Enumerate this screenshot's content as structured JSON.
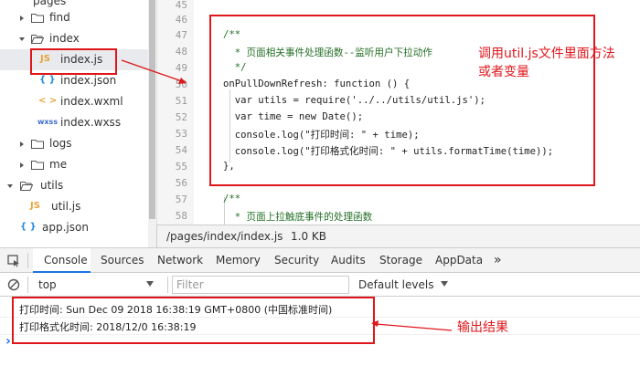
{
  "tree": {
    "items": [
      {
        "label": "find",
        "type": "folder",
        "expanded": false
      },
      {
        "label": "index",
        "type": "folder",
        "expanded": true
      },
      {
        "label": "index.js",
        "type": "file",
        "badge": "JS",
        "selected": true
      },
      {
        "label": "index.json",
        "type": "file",
        "badge": "{ }"
      },
      {
        "label": "index.wxml",
        "type": "file",
        "badge": "< >"
      },
      {
        "label": "index.wxss",
        "type": "file",
        "badge": "wxss"
      },
      {
        "label": "logs",
        "type": "folder",
        "expanded": false
      },
      {
        "label": "me",
        "type": "folder",
        "expanded": false
      },
      {
        "label": "utils",
        "type": "folder",
        "expanded": true
      },
      {
        "label": "util.js",
        "type": "file",
        "badge": "JS"
      },
      {
        "label": "app.json",
        "type": "file",
        "badge": "{ }"
      }
    ]
  },
  "editor": {
    "line_numbers": [
      "45",
      "46",
      "47",
      "48",
      "49",
      "50",
      "51",
      "52",
      "53",
      "54",
      "55",
      "56",
      "57",
      "58"
    ],
    "lines": [
      "/**",
      "  * 页面相关事件处理函数--监听用户下拉动作",
      "  */",
      "onPullDownRefresh: function () {",
      "  var utils = require('../../utils/util.js');",
      "  var time = new Date();",
      "  console.log(\"打印时间: \" + time);",
      "  console.log(\"打印格式化时间: \" + utils.formatTime(time));",
      "},",
      "/**",
      "  * 页面上拉触底事件的处理函数"
    ]
  },
  "statusbar": {
    "path": "/pages/index/index.js",
    "size": "1.0 KB"
  },
  "devtools": {
    "tabs": [
      "Console",
      "Sources",
      "Network",
      "Memory",
      "Security",
      "Audits",
      "Storage",
      "AppData"
    ],
    "more": "»",
    "context": "top",
    "filter_placeholder": "Filter",
    "levels": "Default levels"
  },
  "console": {
    "logs": [
      "打印时间: Sun Dec 09 2018 16:38:19 GMT+0800 (中国标准时间)",
      "打印格式化时间: 2018/12/0 16:38:19"
    ],
    "prompt": "›"
  },
  "annotations": {
    "note_top": [
      "调用util.js文件里面方法",
      "或者变量"
    ],
    "note_bottom": "输出结果"
  },
  "colors": {
    "annotation": "#e0161b",
    "js_badge": "#e8a33b",
    "json_badge": "#1f8ce0",
    "wxml_badge": "#e8a33b",
    "wxss_badge": "#3b6ccb"
  }
}
